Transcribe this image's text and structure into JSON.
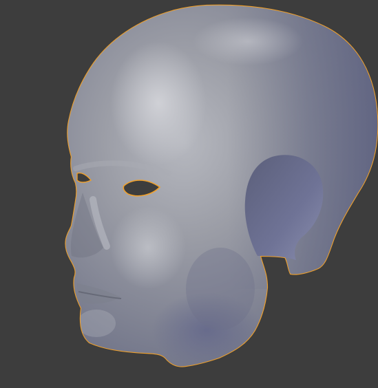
{
  "viewport": {
    "background_color": "#3d3d3d",
    "object": {
      "name": "",
      "selected": true,
      "selection_outline_color": "#f0a02a",
      "material_base_color": "#8d9099",
      "material_shadow_color": "#6a6e84",
      "material_highlight_color": "#c9cbd1",
      "icon": "head-mesh-icon"
    }
  }
}
